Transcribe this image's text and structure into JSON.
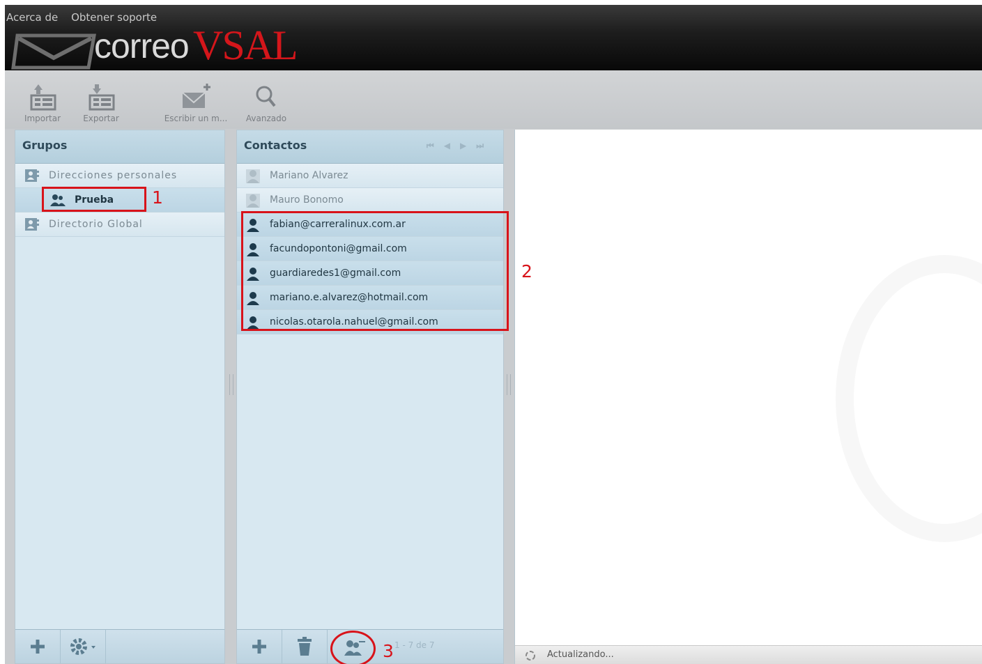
{
  "header": {
    "links": [
      "Acerca de",
      "Obtener soporte"
    ],
    "logo_word": "correo",
    "logo_brand": "VSAL"
  },
  "toolbar": {
    "import_label": "Importar",
    "export_label": "Exportar",
    "compose_label": "Escribir un m...",
    "advanced_label": "Avanzado"
  },
  "groups": {
    "title": "Grupos",
    "personal": "Direcciones personales",
    "group_prueba": "Prueba",
    "global": "Directorio Global"
  },
  "contacts": {
    "title": "Contactos",
    "items": [
      "Mariano Alvarez",
      "Mauro Bonomo",
      "fabian@carreralinux.com.ar",
      "facundopontoni@gmail.com",
      "guardiaredes1@gmail.com",
      "mariano.e.alvarez@hotmail.com",
      "nicolas.otarola.nahuel@gmail.com"
    ],
    "count": "1 - 7 de 7"
  },
  "status": {
    "text": "Actualizando..."
  },
  "annotations": [
    "1",
    "2",
    "3"
  ],
  "colors": {
    "annotation": "#d8131a",
    "brand_red": "#d4161b",
    "panel_bg": "#d8e8f1",
    "header_text": "#2f4a5a"
  }
}
